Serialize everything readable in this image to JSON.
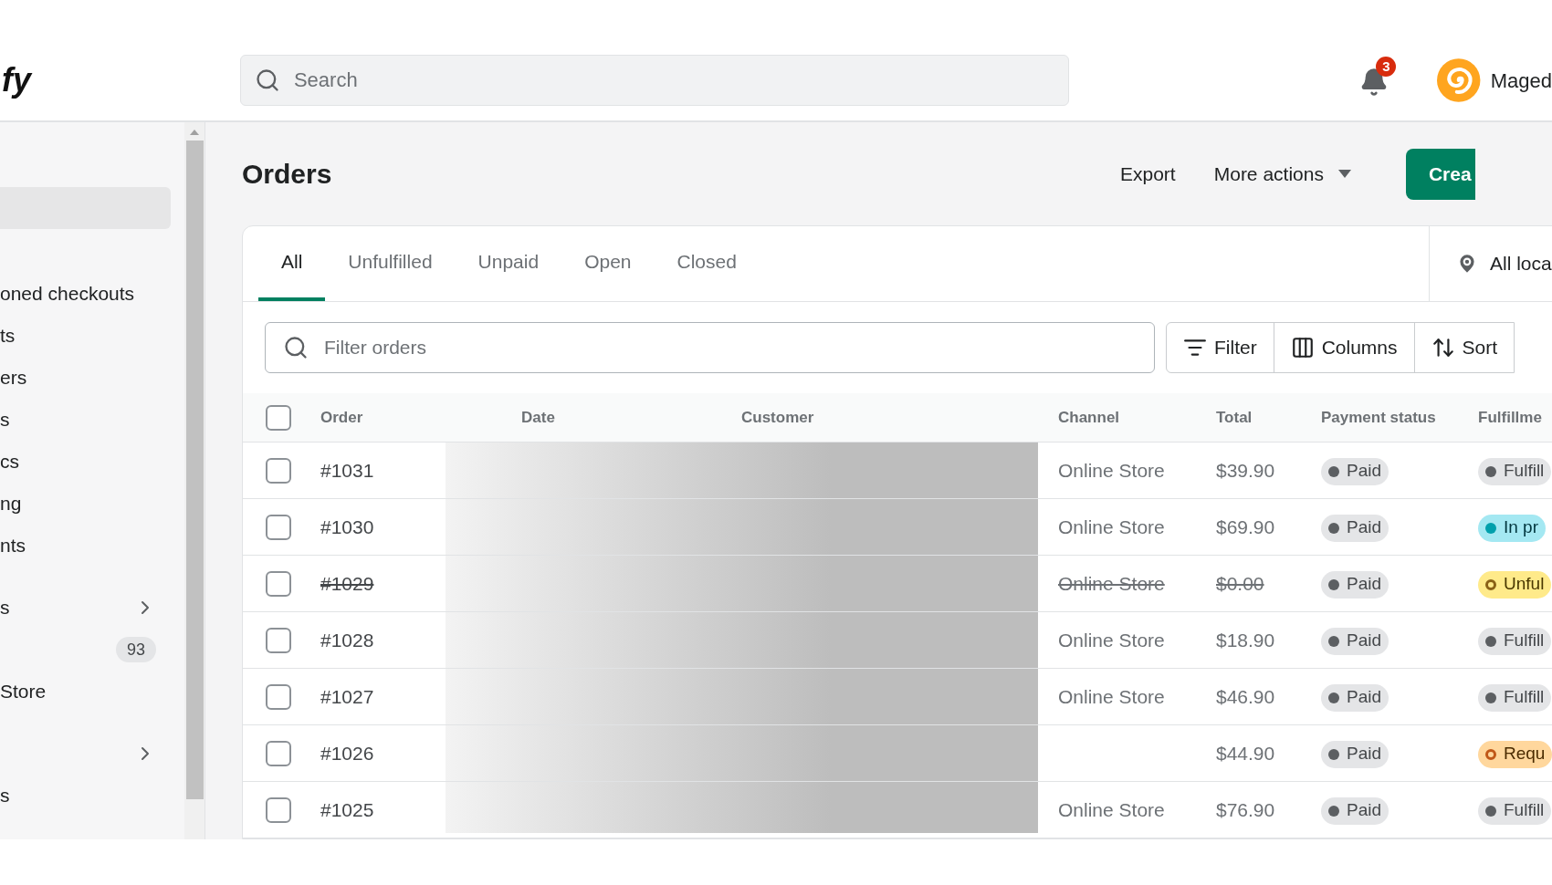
{
  "topbar": {
    "logo": "fy",
    "search": {
      "placeholder": "Search"
    },
    "notifications": {
      "count": "3"
    },
    "user": {
      "name": "Maged"
    }
  },
  "sidebar": {
    "sections": [
      {
        "items": [
          {
            "selected": true
          }
        ]
      },
      {
        "items": [
          {
            "label": "oned checkouts",
            "selected": false
          },
          {
            "label": "ts",
            "selected": false
          },
          {
            "label": "ers",
            "selected": false
          },
          {
            "label": "s",
            "selected": false
          },
          {
            "label": "cs",
            "selected": false
          },
          {
            "label": "ng",
            "selected": false
          },
          {
            "label": "nts",
            "selected": false
          }
        ]
      },
      {
        "items": [
          {
            "label": "s",
            "selected": false,
            "kind": "expand"
          },
          {
            "count": "93",
            "selected": false
          },
          {
            "label": "Store",
            "selected": false
          }
        ]
      },
      {
        "items": [
          {
            "selected": false,
            "kind": "expand"
          },
          {
            "label": "s",
            "selected": false
          }
        ]
      }
    ]
  },
  "page": {
    "title": "Orders",
    "actions": [
      {
        "label": "Export",
        "kind": "plain"
      },
      {
        "label": "More actions",
        "kind": "menu"
      },
      {
        "label": "Crea",
        "kind": "primary"
      }
    ]
  },
  "tabs": [
    {
      "label": "All",
      "selected": true
    },
    {
      "label": "Unfulfilled",
      "selected": false
    },
    {
      "label": "Unpaid",
      "selected": false
    },
    {
      "label": "Open",
      "selected": false
    },
    {
      "label": "Closed",
      "selected": false
    }
  ],
  "location": {
    "label": "All loca"
  },
  "filter": {
    "placeholder": "Filter orders",
    "buttons": [
      {
        "label": "Filter",
        "kind": "filter"
      },
      {
        "label": "Columns",
        "kind": "columns"
      },
      {
        "label": "Sort",
        "kind": "sort"
      }
    ]
  },
  "table": {
    "all_checked": false,
    "columns": [
      "Order",
      "Date",
      "Customer",
      "Channel",
      "Total",
      "Payment status",
      "Fulfillme"
    ],
    "rows": [
      {
        "checked": false,
        "cancelled": false,
        "order": "#1031",
        "channel": "Online Store",
        "total": "$39.90",
        "payment": {
          "label": "Paid",
          "kind": "complete"
        },
        "fulfillment": {
          "label": "Fulfill",
          "kind": "complete"
        }
      },
      {
        "checked": false,
        "cancelled": false,
        "order": "#1030",
        "channel": "Online Store",
        "total": "$69.90",
        "payment": {
          "label": "Paid",
          "kind": "complete"
        },
        "fulfillment": {
          "label": "In pr",
          "kind": "progress"
        }
      },
      {
        "checked": false,
        "cancelled": true,
        "order": "#1029",
        "channel": "Online Store",
        "total": "$0.00",
        "payment": {
          "label": "Paid",
          "kind": "complete"
        },
        "fulfillment": {
          "label": "Unful",
          "kind": "warning"
        }
      },
      {
        "checked": false,
        "cancelled": false,
        "order": "#1028",
        "channel": "Online Store",
        "total": "$18.90",
        "payment": {
          "label": "Paid",
          "kind": "complete"
        },
        "fulfillment": {
          "label": "Fulfill",
          "kind": "complete"
        }
      },
      {
        "checked": false,
        "cancelled": false,
        "order": "#1027",
        "channel": "Online Store",
        "total": "$46.90",
        "payment": {
          "label": "Paid",
          "kind": "complete"
        },
        "fulfillment": {
          "label": "Fulfill",
          "kind": "complete"
        }
      },
      {
        "checked": false,
        "cancelled": false,
        "order": "#1026",
        "total": "$44.90",
        "payment": {
          "label": "Paid",
          "kind": "complete"
        },
        "fulfillment": {
          "label": "Requ",
          "kind": "attention"
        }
      },
      {
        "checked": false,
        "cancelled": false,
        "order": "#1025",
        "channel": "Online Store",
        "total": "$76.90",
        "payment": {
          "label": "Paid",
          "kind": "complete"
        },
        "fulfillment": {
          "label": "Fulfill",
          "kind": "complete"
        }
      }
    ]
  }
}
